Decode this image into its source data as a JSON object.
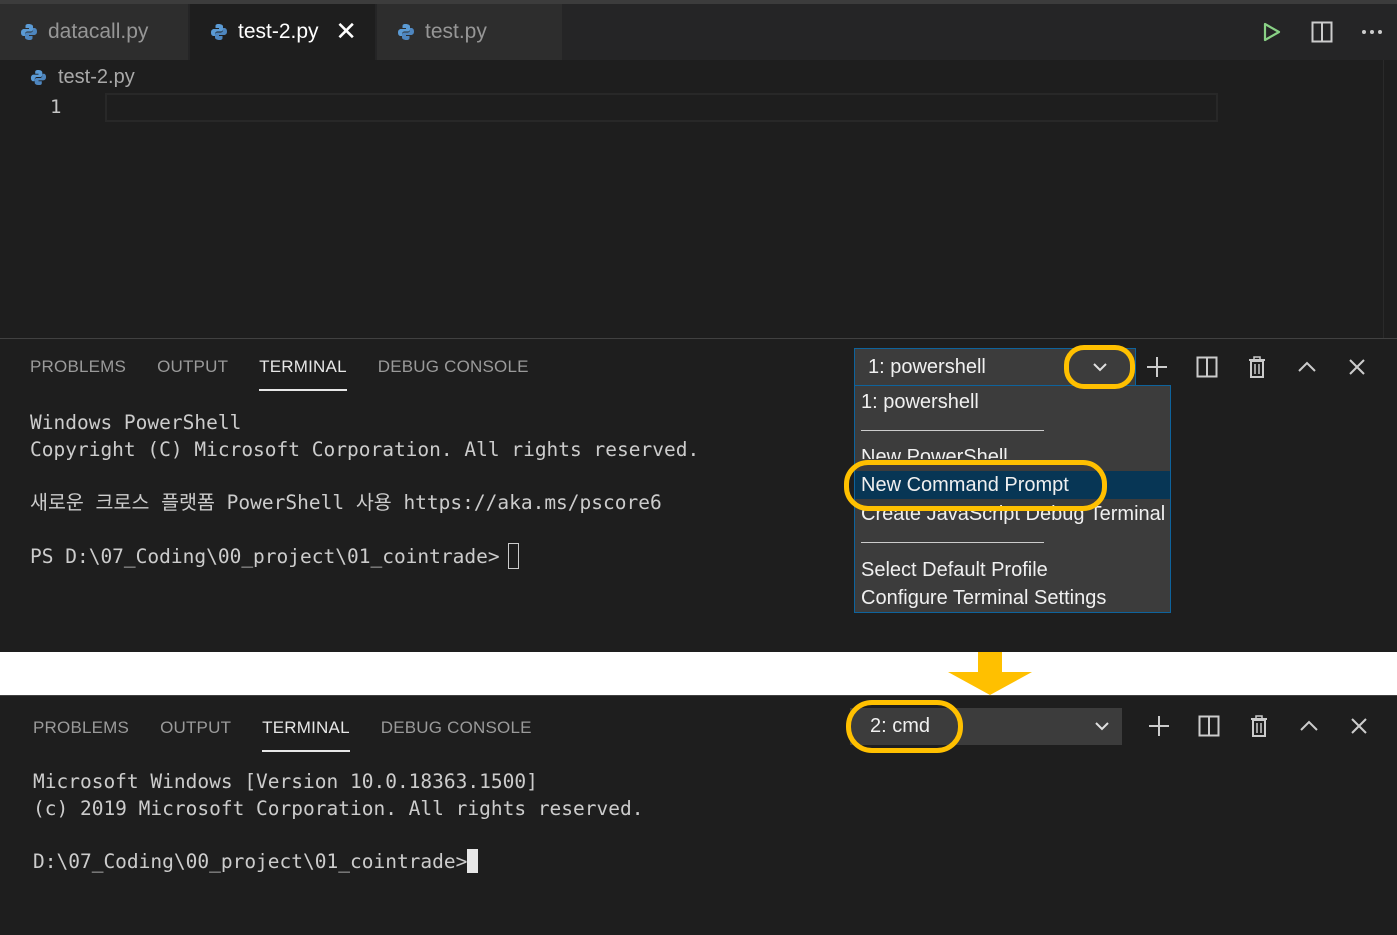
{
  "editor": {
    "tabs": [
      {
        "label": "datacall.py",
        "active": false
      },
      {
        "label": "test-2.py",
        "active": true
      },
      {
        "label": "test.py",
        "active": false
      }
    ],
    "close_glyph": "✕",
    "breadcrumb": "test-2.py",
    "line_number": "1"
  },
  "panel": {
    "tabs": [
      "PROBLEMS",
      "OUTPUT",
      "TERMINAL",
      "DEBUG CONSOLE"
    ],
    "active_tab": "TERMINAL"
  },
  "top_terminal": {
    "lines": [
      "Windows PowerShell",
      "Copyright (C) Microsoft Corporation. All rights reserved.",
      "새로운 크로스 플랫폼 PowerShell 사용 https://aka.ms/pscore6",
      "PS D:\\07_Coding\\00_project\\01_cointrade>"
    ],
    "selected_terminal": "1: powershell"
  },
  "dropdown": {
    "items": [
      "1: powershell",
      "New PowerShell",
      "New Command Prompt",
      "Create JavaScript Debug Terminal",
      "Select Default Profile",
      "Configure Terminal Settings"
    ],
    "highlighted": "New Command Prompt"
  },
  "bottom_terminal": {
    "selected_terminal": "2: cmd",
    "lines": [
      "Microsoft Windows [Version 10.0.18363.1500]",
      "(c) 2019 Microsoft Corporation. All rights reserved.",
      "D:\\07_Coding\\00_project\\01_cointrade>"
    ]
  },
  "colors": {
    "highlight": "#ffc000",
    "background": "#1e1e1e",
    "focus_border": "#0e639c",
    "selection": "#073655",
    "run_icon": "#89d185"
  },
  "icons": [
    "python-file-icon",
    "run-icon",
    "split-editor-icon",
    "more-actions-icon",
    "chevron-down-icon",
    "plus-icon",
    "split-terminal-icon",
    "trash-icon",
    "chevron-up-icon",
    "close-icon",
    "down-arrow-icon"
  ]
}
